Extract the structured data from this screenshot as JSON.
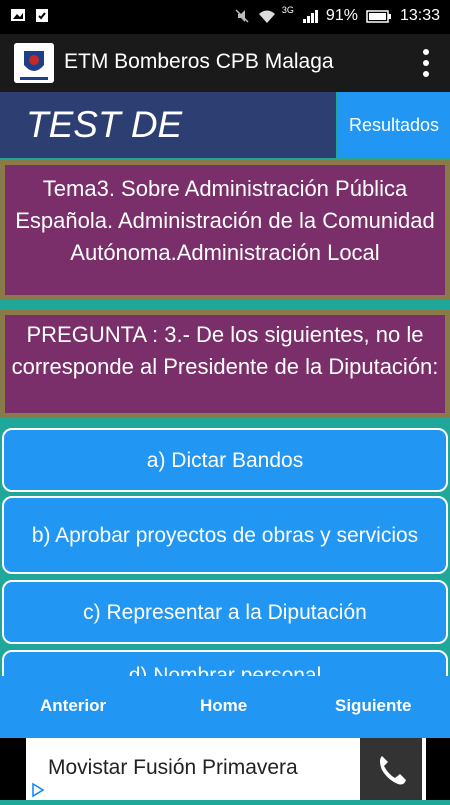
{
  "status_bar": {
    "signal": "3G",
    "battery": "91%",
    "time": "13:33"
  },
  "app_bar": {
    "title": "ETM Bomberos CPB Malaga",
    "menu_icon": "overflow-menu-icon"
  },
  "header": {
    "title": "TEST DE EXAMEN",
    "results_label": "Resultados"
  },
  "topic": {
    "text": "Tema3. Sobre Administración Pública Española. Administración de la Comunidad Autónoma.Administración Local"
  },
  "question": {
    "text": "PREGUNTA : 3.- De los siguientes, no le corresponde al Presidente de la Diputación:"
  },
  "answers": [
    {
      "label": "a) Dictar Bandos"
    },
    {
      "label": "b) Aprobar proyectos de obras y servicios"
    },
    {
      "label": "c) Representar a la Diputación"
    },
    {
      "label": "d) Nombrar personal"
    }
  ],
  "bottom_nav": {
    "previous": "Anterior",
    "home": "Home",
    "next": "Siguiente"
  },
  "ad": {
    "text": "Movistar Fusión Primavera",
    "icon": "phone-icon"
  },
  "colors": {
    "accent": "#2196f3",
    "header_dark": "#2d3e73",
    "card": "#7a2f6a",
    "card_border": "#8a7a4a",
    "background": "#1fa89a"
  }
}
